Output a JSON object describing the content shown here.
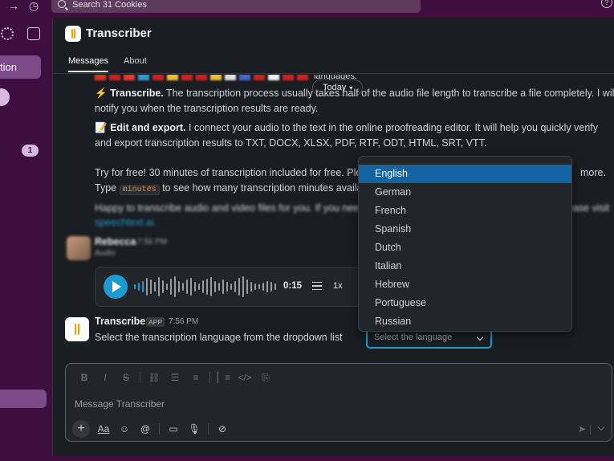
{
  "topbar": {
    "search_placeholder": "Search 31 Cookies",
    "icons": [
      "arrow-right-icon",
      "history-icon",
      "help-icon"
    ]
  },
  "sidebar": {
    "active_item_label": "tion",
    "badge_count": "1"
  },
  "channel": {
    "title": "Transcriber",
    "tabs": [
      "Messages",
      "About"
    ]
  },
  "messages": {
    "flags_suffix": "languages.",
    "today_label": "Today",
    "transcribe_emoji": "⚡",
    "transcribe_title": "Transcribe.",
    "transcribe_text_1": " The transcription process usually takes half of the audio file length to transcribe a file completely. I will",
    "transcribe_text_2": "notify you when the transcription results are ready.",
    "edit_emoji": "📝",
    "edit_title": "Edit and export.",
    "edit_text_1": " I connect your audio to the text in the online proofreading editor. It will help you quickly verify",
    "edit_text_2": "and export transcription results to TXT, DOCX, XLSX, PDF, RTF, ODT, HTML, SRT, VTT.",
    "trial_text_1": "Try for free! 30 minutes of transcription included for free. Ple",
    "trial_text_1_end": "more.",
    "trial_text_2_prefix": "Type ",
    "trial_code": "minutes",
    "trial_text_2_suffix": " to see how many transcription minutes availab",
    "happy_text": "Happy to transcribe audio and video files for you. If you need",
    "happy_text_end": "ease visit",
    "happy_link": "speechtext.ai."
  },
  "audio_message": {
    "sender": "Rebecca",
    "time": "7:56 PM",
    "subtitle": "Audio",
    "duration": "0:15",
    "speed": "1x"
  },
  "bot_message": {
    "sender": "Transcriber",
    "app_tag": "APP",
    "time": "7:56 PM",
    "text": "Select the transcription language from the dropdown list",
    "select_placeholder": "Select the language"
  },
  "dropdown": {
    "options": [
      "English",
      "German",
      "French",
      "Spanish",
      "Dutch",
      "Italian",
      "Hebrew",
      "Portuguese",
      "Russian"
    ],
    "highlighted": "English"
  },
  "composer": {
    "placeholder": "Message Transcriber",
    "format_buttons": [
      "B",
      "I",
      "S",
      "link",
      "ordered-list",
      "bullet-list",
      "blockquote",
      "code",
      "code-block"
    ],
    "action_buttons": [
      "+",
      "Aa",
      "emoji",
      "@",
      "video",
      "mic",
      "slash"
    ]
  }
}
